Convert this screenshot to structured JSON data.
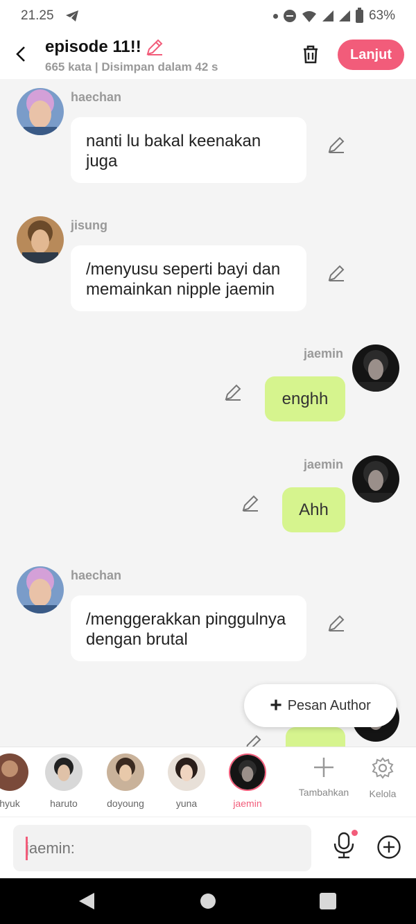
{
  "status_bar": {
    "time": "21.25",
    "battery": "63%"
  },
  "header": {
    "title": "episode 11!!",
    "subtitle": "665 kata | Disimpan dalam 42 s",
    "next_button": "Lanjut"
  },
  "messages": [
    {
      "sender": "haechan",
      "text": "nanti lu bakal keenakan juga",
      "side": "left"
    },
    {
      "sender": "jisung",
      "text": "/menyusu seperti bayi dan memainkan nipple jaemin",
      "side": "left"
    },
    {
      "sender": "jaemin",
      "text": "enghh",
      "side": "right"
    },
    {
      "sender": "jaemin",
      "text": "Ahh",
      "side": "right"
    },
    {
      "sender": "haechan",
      "text": "/menggerakkan pinggulnya dengan brutal",
      "side": "left"
    }
  ],
  "pesan_author_label": "Pesan Author",
  "characters": [
    {
      "name": "hyuk"
    },
    {
      "name": "haruto"
    },
    {
      "name": "doyoung"
    },
    {
      "name": "yuna"
    },
    {
      "name": "jaemin",
      "active": true
    }
  ],
  "tools": {
    "add": "Tambahkan",
    "manage": "Kelola"
  },
  "input": {
    "placeholder": "jaemin:"
  },
  "colors": {
    "accent": "#f25c7a",
    "bubble_green": "#d6f48e",
    "background": "#f4f4f4"
  }
}
